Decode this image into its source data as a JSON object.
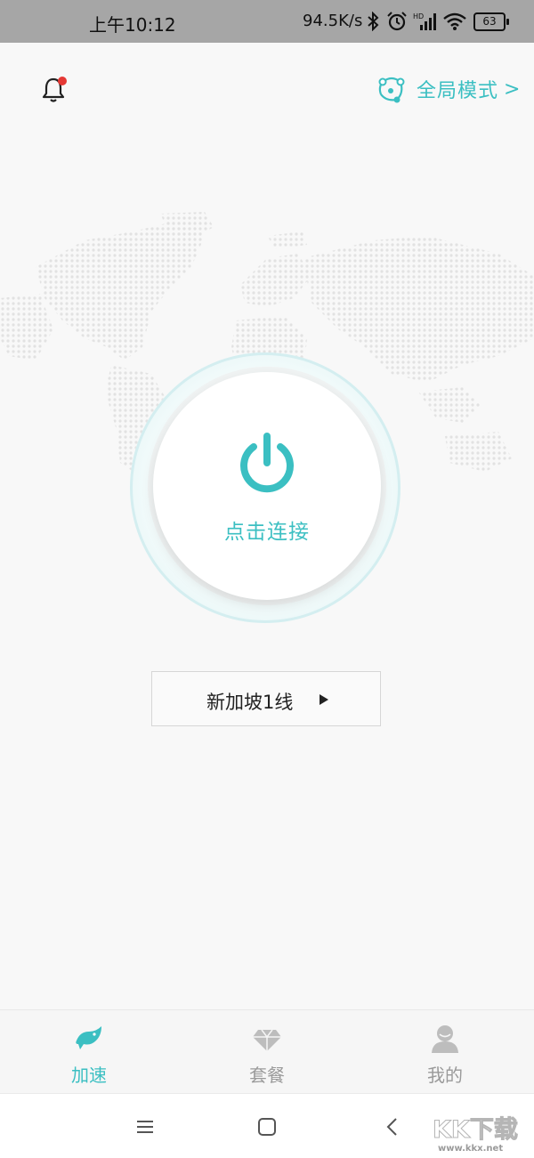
{
  "status_bar": {
    "time": "上午10:12",
    "net_speed": "94.5K/s",
    "battery": "63",
    "icons": [
      "bluetooth-icon",
      "alarm-icon",
      "hd-signal-icon",
      "wifi-icon",
      "battery-icon"
    ]
  },
  "header": {
    "notification_icon": "bell-icon",
    "has_unread": true,
    "mode_icon": "network-nodes-icon",
    "mode_label": "全局模式",
    "mode_chevron": ">"
  },
  "connect": {
    "icon": "power-icon",
    "label": "点击连接"
  },
  "server": {
    "label": "新加坡1线",
    "arrow_icon": "play-arrow-icon"
  },
  "bottom_nav": {
    "items": [
      {
        "label": "加速",
        "icon": "bird-icon",
        "active": true
      },
      {
        "label": "套餐",
        "icon": "diamond-icon",
        "active": false
      },
      {
        "label": "我的",
        "icon": "user-icon",
        "active": false
      }
    ]
  },
  "system_nav": [
    "menu-icon",
    "home-icon",
    "back-icon"
  ],
  "watermark": {
    "logo_text": "KK下载",
    "url": "www.kkx.net"
  },
  "colors": {
    "accent": "#3bbfc2",
    "inactive": "#b8b8b8",
    "status_bar_bg": "#a6a6a6",
    "page_bg": "#f8f8f8",
    "alert_dot": "#e53935"
  }
}
